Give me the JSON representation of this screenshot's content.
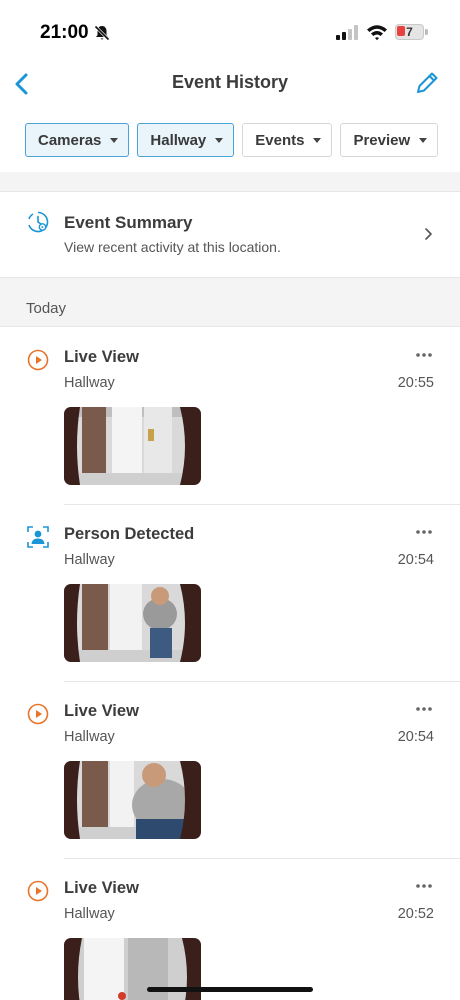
{
  "status": {
    "time": "21:00",
    "battery": "7"
  },
  "header": {
    "title": "Event History"
  },
  "filters": [
    {
      "label": "Cameras",
      "active": true
    },
    {
      "label": "Hallway",
      "active": true
    },
    {
      "label": "Events",
      "active": false
    },
    {
      "label": "Preview",
      "active": false
    }
  ],
  "summary": {
    "title": "Event Summary",
    "subtitle": "View recent activity at this location."
  },
  "section": {
    "label": "Today"
  },
  "events": [
    {
      "type": "live-view",
      "title": "Live View",
      "camera": "Hallway",
      "time": "20:55"
    },
    {
      "type": "person",
      "title": "Person Detected",
      "camera": "Hallway",
      "time": "20:54"
    },
    {
      "type": "live-view",
      "title": "Live View",
      "camera": "Hallway",
      "time": "20:54"
    },
    {
      "type": "live-view",
      "title": "Live View",
      "camera": "Hallway",
      "time": "20:52"
    }
  ],
  "colors": {
    "accent": "#1a95d6",
    "live_view": "#e8742b",
    "battery_low": "#e8423e"
  }
}
